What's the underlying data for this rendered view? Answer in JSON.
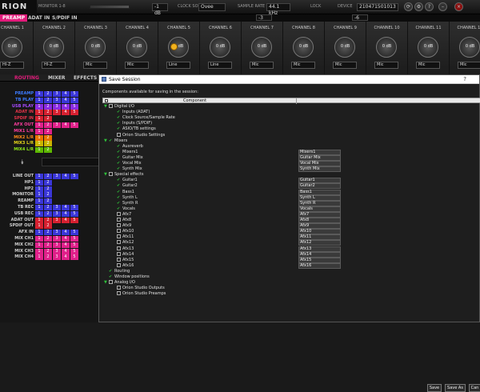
{
  "app": {
    "logo": "RION",
    "monitor_label": "MONITOR 1-8"
  },
  "topbar": {
    "db_left": "-1 dB",
    "clock_source_label": "CLOCK SOURCE",
    "clock_source": "Ovee",
    "sample_rate_label": "SAMPLE RATE",
    "sample_rate": "44.1 kHz",
    "lock_label": "LOCK",
    "device_label": "DEVICE",
    "device_id": "210471501013",
    "db_right1": "-3 dB",
    "db_right2": "-6 dB"
  },
  "tabs": [
    "PREAMP",
    "ADAT IN",
    "S/PDIF IN"
  ],
  "channels": [
    {
      "name": "CHANNEL 1",
      "value": "0 dB",
      "sel": "HI-Z"
    },
    {
      "name": "CHANNEL 2",
      "value": "0 dB",
      "sel": "HI-Z"
    },
    {
      "name": "CHANNEL 3",
      "value": "0 dB",
      "sel": "Mic"
    },
    {
      "name": "CHANNEL 4",
      "value": "0 dB",
      "sel": "Mic"
    },
    {
      "name": "CHANNEL 5",
      "value": "0 dB",
      "sel": "Line"
    },
    {
      "name": "CHANNEL 6",
      "value": "0 dB",
      "sel": "Line"
    },
    {
      "name": "CHANNEL 7",
      "value": "0 dB",
      "sel": "Mic"
    },
    {
      "name": "CHANNEL 8",
      "value": "0 dB",
      "sel": "Mic"
    },
    {
      "name": "CHANNEL 9",
      "value": "0 dB",
      "sel": "Mic"
    },
    {
      "name": "CHANNEL 10",
      "value": "0 dB",
      "sel": "Mic"
    },
    {
      "name": "CHANNEL 11",
      "value": "0 dB",
      "sel": "Mic"
    },
    {
      "name": "CHANNEL 12",
      "value": "0 dB",
      "sel": "Mic"
    }
  ],
  "left": {
    "subtabs": [
      "ROUTING",
      "MIXER",
      "EFFECTS"
    ],
    "rows_top": [
      {
        "label": "PREAMP",
        "color": "#3d7bff",
        "cells": [
          "1",
          "2",
          "3",
          "4",
          "5"
        ],
        "cellcolor": "#3a36d8"
      },
      {
        "label": "TB PLAY",
        "color": "#3d7bff",
        "cells": [
          "1",
          "2",
          "3",
          "4",
          "5"
        ],
        "cellcolor": "#3a36d8"
      },
      {
        "label": "USB PLAY",
        "color": "#a64bff",
        "cells": [
          "1",
          "2",
          "3",
          "4",
          "5"
        ],
        "cellcolor": "#8a2be2"
      },
      {
        "label": "ADAT IN",
        "color": "#e8344a",
        "cells": [
          "1",
          "2",
          "3",
          "4",
          "5"
        ],
        "cellcolor": "#d62030"
      },
      {
        "label": "SPDIF IN",
        "color": "#e8344a",
        "cells": [
          "1",
          "2"
        ],
        "cellcolor": "#d62030"
      },
      {
        "label": "AFX OUT",
        "color": "#ff3da0",
        "cells": [
          "1",
          "2",
          "3",
          "4",
          "5"
        ],
        "cellcolor": "#e0208a"
      },
      {
        "label": "MIX1 L/R",
        "color": "#ff3da0",
        "cells": [
          "1",
          "2"
        ],
        "cellcolor": "#e0208a"
      },
      {
        "label": "MIX2 L/R",
        "color": "#ff8a1a",
        "cells": [
          "1",
          "2"
        ],
        "cellcolor": "#e87400"
      },
      {
        "label": "MIX3 L/R",
        "color": "#e8d81a",
        "cells": [
          "1",
          "2"
        ],
        "cellcolor": "#c9b400"
      },
      {
        "label": "MIX4 L/R",
        "color": "#8fe81a",
        "cells": [
          "1",
          "2"
        ],
        "cellcolor": "#5eb800"
      }
    ],
    "rows_bottom": [
      {
        "label": "LINE OUT",
        "color": "#d0d0d0",
        "cells": [
          "1",
          "2",
          "3",
          "4",
          "5"
        ],
        "cellcolor": "#3a36d8"
      },
      {
        "label": "HP1",
        "color": "#d0d0d0",
        "cells": [
          "1",
          "2"
        ],
        "cellcolor": "#3a36d8"
      },
      {
        "label": "HP2",
        "color": "#d0d0d0",
        "cells": [
          "1",
          "2"
        ],
        "cellcolor": "#3a36d8"
      },
      {
        "label": "MONITOR",
        "color": "#d0d0d0",
        "cells": [
          "1",
          "2"
        ],
        "cellcolor": "#3a36d8"
      },
      {
        "label": "REAMP",
        "color": "#d0d0d0",
        "cells": [
          "1",
          "2"
        ],
        "cellcolor": "#3a36d8"
      },
      {
        "label": "TB REC",
        "color": "#d0d0d0",
        "cells": [
          "1",
          "2",
          "3",
          "4",
          "5"
        ],
        "cellcolor": "#3a36d8"
      },
      {
        "label": "USB REC",
        "color": "#d0d0d0",
        "cells": [
          "1",
          "2",
          "3",
          "4",
          "5"
        ],
        "cellcolor": "#3a36d8"
      },
      {
        "label": "ADAT OUT",
        "color": "#d0d0d0",
        "cells": [
          "1",
          "2",
          "3",
          "4",
          "5"
        ],
        "cellcolor": "#d62030"
      },
      {
        "label": "SPDIF OUT",
        "color": "#d0d0d0",
        "cells": [
          "1",
          "2"
        ],
        "cellcolor": "#d62030"
      },
      {
        "label": "AFX IN",
        "color": "#d0d0d0",
        "cells": [
          "1",
          "2",
          "3",
          "4",
          "5"
        ],
        "cellcolor": "#3a36d8"
      },
      {
        "label": "MIX CH1",
        "color": "#d0d0d0",
        "cells": [
          "1",
          "2",
          "3",
          "4",
          "5"
        ],
        "cellcolor": "#e0208a"
      },
      {
        "label": "MIX CH2",
        "color": "#d0d0d0",
        "cells": [
          "1",
          "2",
          "3",
          "4",
          "5"
        ],
        "cellcolor": "#e0208a"
      },
      {
        "label": "MIX CH3",
        "color": "#d0d0d0",
        "cells": [
          "1",
          "2",
          "3",
          "4",
          "5"
        ],
        "cellcolor": "#e0208a"
      },
      {
        "label": "MIX CH4",
        "color": "#d0d0d0",
        "cells": [
          "1",
          "2",
          "3",
          "4",
          "5"
        ],
        "cellcolor": "#e0208a"
      }
    ]
  },
  "dialog": {
    "title": "Save Session",
    "help": "?",
    "description": "Components available for saving in the session:",
    "column_header": "Component",
    "tree": [
      {
        "label": "Digital I/O",
        "level": 0,
        "type": "group-cb",
        "expanded": true
      },
      {
        "label": "Inputs (ADAT)",
        "level": 1,
        "type": "check"
      },
      {
        "label": "Clock Source/Sample Rate",
        "level": 1,
        "type": "check"
      },
      {
        "label": "Inputs (S/PDIF)",
        "level": 1,
        "type": "check"
      },
      {
        "label": "ASIO/TB settings",
        "level": 1,
        "type": "check"
      },
      {
        "label": "Orion Studio Settings",
        "level": 1,
        "type": "cb"
      },
      {
        "label": "Mixers",
        "level": 0,
        "type": "group-check",
        "expanded": true
      },
      {
        "label": "Auxreverb",
        "level": 1,
        "type": "check"
      },
      {
        "label": "Mixers1",
        "level": 1,
        "type": "check",
        "cell": "Mixers1"
      },
      {
        "label": "Guitar Mix",
        "level": 1,
        "type": "check",
        "cell": "Guitar Mix"
      },
      {
        "label": "Vocal Mix",
        "level": 1,
        "type": "check",
        "cell": "Vocal Mix"
      },
      {
        "label": "Synth Mix",
        "level": 1,
        "type": "check",
        "cell": "Synth Mix"
      },
      {
        "label": "Special effects",
        "level": 0,
        "type": "group-cb",
        "expanded": true
      },
      {
        "label": "Guitar1",
        "level": 1,
        "type": "check",
        "cell": "Guitar1"
      },
      {
        "label": "Guitar2",
        "level": 1,
        "type": "check",
        "cell": "Guitar2"
      },
      {
        "label": "Bass1",
        "level": 1,
        "type": "check",
        "cell": "Bass1"
      },
      {
        "label": "Synth L",
        "level": 1,
        "type": "check",
        "cell": "Synth L"
      },
      {
        "label": "Synth R",
        "level": 1,
        "type": "check",
        "cell": "Synth R"
      },
      {
        "label": "Vocals",
        "level": 1,
        "type": "check",
        "cell": "Vocals"
      },
      {
        "label": "Afx7",
        "level": 1,
        "type": "cb",
        "cell": "Afx7"
      },
      {
        "label": "Afx8",
        "level": 1,
        "type": "cb",
        "cell": "Afx8"
      },
      {
        "label": "Afx9",
        "level": 1,
        "type": "cb",
        "cell": "Afx9"
      },
      {
        "label": "Afx10",
        "level": 1,
        "type": "cb",
        "cell": "Afx10"
      },
      {
        "label": "Afx11",
        "level": 1,
        "type": "cb",
        "cell": "Afx11"
      },
      {
        "label": "Afx12",
        "level": 1,
        "type": "cb",
        "cell": "Afx12"
      },
      {
        "label": "Afx13",
        "level": 1,
        "type": "cb",
        "cell": "Afx13"
      },
      {
        "label": "Afx14",
        "level": 1,
        "type": "cb",
        "cell": "Afx14"
      },
      {
        "label": "Afx15",
        "level": 1,
        "type": "cb",
        "cell": "Afx15"
      },
      {
        "label": "Afx16",
        "level": 1,
        "type": "cb",
        "cell": "Afx16"
      },
      {
        "label": "Routing",
        "level": 0,
        "type": "check"
      },
      {
        "label": "Window positions",
        "level": 0,
        "type": "check"
      },
      {
        "label": "Analog I/O",
        "level": 0,
        "type": "group-cb",
        "expanded": true
      },
      {
        "label": "Orion Studio Outputs",
        "level": 1,
        "type": "cb"
      },
      {
        "label": "Orion Studio Preamps",
        "level": 1,
        "type": "cb"
      }
    ],
    "buttons": {
      "save": "Save",
      "save_as": "Save As",
      "cancel": "Can"
    }
  }
}
